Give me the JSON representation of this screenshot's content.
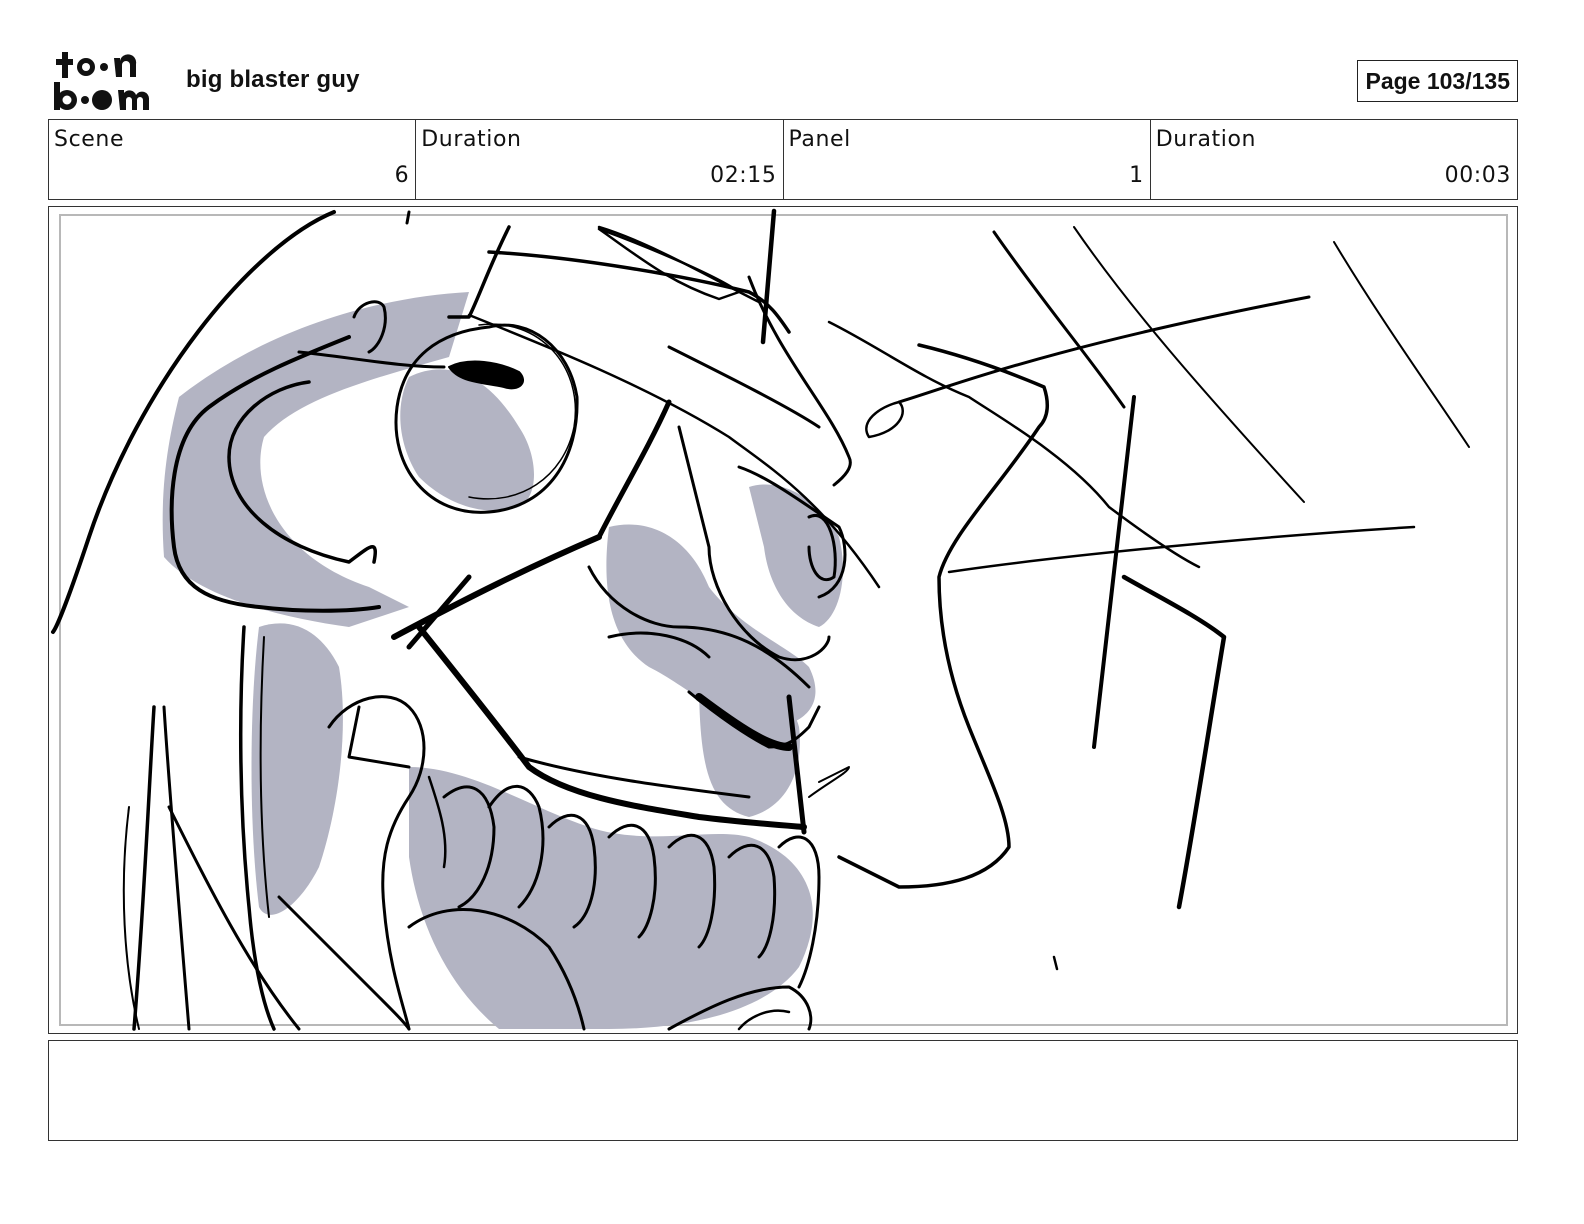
{
  "header": {
    "logo_text": "toon boom",
    "project_title": "big blaster guy",
    "page_indicator": "Page 103/135"
  },
  "info": {
    "scene_label": "Scene",
    "scene_value": "6",
    "scene_duration_label": "Duration",
    "scene_duration_value": "02:15",
    "panel_label": "Panel",
    "panel_value": "1",
    "panel_duration_label": "Duration",
    "panel_duration_value": "00:03"
  },
  "panel": {
    "shade_color": "#b3b4c3",
    "ink_color": "#000000"
  },
  "notes": {
    "text": ""
  }
}
